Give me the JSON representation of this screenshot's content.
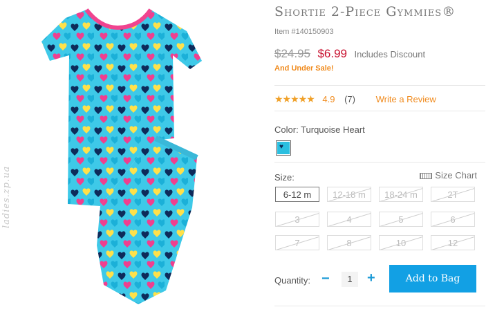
{
  "product": {
    "title": "Shortie 2-Piece Gymmies®",
    "item_number": "Item #140150903",
    "original_price": "$24.95",
    "sale_price": "$6.99",
    "discount_note": "Includes Discount",
    "sale_note": "And Under Sale!",
    "image_name": "turquoise heart pajama set"
  },
  "rating": {
    "stars": "★★★★★",
    "value": "4.9",
    "count": "(7)",
    "write_review": "Write a Review"
  },
  "color": {
    "label": "Color: Turquoise Heart",
    "swatch_color": "#2bbfe0"
  },
  "size": {
    "label": "Size:",
    "chart_label": "Size Chart",
    "options": [
      {
        "label": "6-12 m",
        "available": true,
        "selected": true
      },
      {
        "label": "12-18 m",
        "available": false
      },
      {
        "label": "18-24 m",
        "available": false
      },
      {
        "label": "2T",
        "available": false
      },
      {
        "label": "3",
        "available": false
      },
      {
        "label": "4",
        "available": false
      },
      {
        "label": "5",
        "available": false
      },
      {
        "label": "6",
        "available": false
      },
      {
        "label": "7",
        "available": false
      },
      {
        "label": "8",
        "available": false
      },
      {
        "label": "10",
        "available": false
      },
      {
        "label": "12",
        "available": false
      }
    ]
  },
  "quantity": {
    "label": "Quantity:",
    "minus": "−",
    "value": "1",
    "plus": "+"
  },
  "actions": {
    "add_to_bag": "Add to Bag"
  },
  "watermark": "ladies.zp.ua",
  "colors": {
    "accent_blue": "#12a0e4",
    "sale_red": "#c8102e",
    "orange": "#f08a1c"
  }
}
